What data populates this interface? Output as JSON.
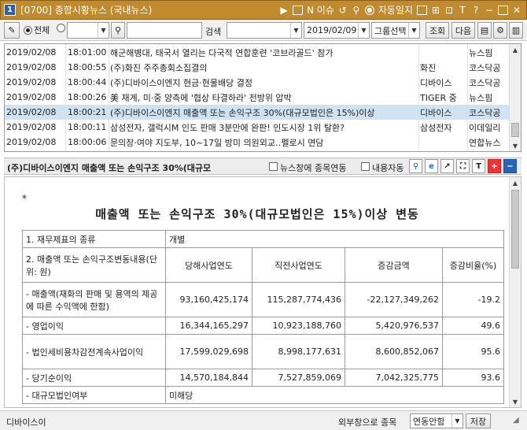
{
  "window": {
    "number": "1",
    "title": "[0700] 종합시황뉴스 (국내뉴스)",
    "buttons": {
      "issue": "N 이슈",
      "autodiary": "자동일지"
    }
  },
  "toolbar": {
    "radio_all": "전체",
    "search_label": "검색",
    "date": "2019/02/09",
    "combo_select": "그룹선택",
    "btn_query": "조회",
    "btn_next": "다음"
  },
  "news": {
    "rows": [
      {
        "date": "2019/02/08",
        "time": "18:01:00",
        "title": "해군해병대, 태국서 열리는 다국적 연합훈련 '코브라골드' 참가",
        "tag": "",
        "source": "뉴스핌",
        "selected": false
      },
      {
        "date": "2019/02/08",
        "time": "18:00:55",
        "title": "(주)화진 주주총회소집결의",
        "tag": "화진",
        "source": "코스닥공",
        "selected": false
      },
      {
        "date": "2019/02/08",
        "time": "18:00:44",
        "title": "(주)디바이스이엔지 현금·현물배당 결정",
        "tag": "디바이스",
        "source": "코스닥공",
        "selected": false
      },
      {
        "date": "2019/02/08",
        "time": "18:00:26",
        "title": "美 재계, 미·중 양측에 '협상 타결하라' 전방위 압박",
        "tag": "TIGER 중",
        "source": "뉴스핌",
        "selected": false
      },
      {
        "date": "2019/02/08",
        "time": "18:00:21",
        "title": "(주)디바이스이엔지 매출액 또는 손익구조 30%(대규모법인은 15%)이상",
        "tag": "디바이스",
        "source": "코스닥공",
        "selected": true
      },
      {
        "date": "2019/02/08",
        "time": "18:00:11",
        "title": "삼성전자, 갤럭시M 인도 판매 3분만에 완판! 인도시장 1위 탈환?",
        "tag": "삼성전자",
        "source": "이데일리",
        "selected": false
      },
      {
        "date": "2019/02/08",
        "time": "18:00:06",
        "title": "문의장·여야 지도부, 10~17일 방미 의원외교‥펠로시 면담",
        "tag": "",
        "source": "연합뉴스",
        "selected": false
      }
    ]
  },
  "headline": {
    "title": "(주)디바이스이엔지 매출액 또는 손익구조 30%(대규모",
    "check_link": "뉴스창에 종목연동",
    "check_content": "내용자동"
  },
  "document": {
    "star": "*",
    "title": "매출액 또는 손익구조 30%(대규모법인은 15%)이상 변동",
    "r1_label": "1. 재무제표의 종류",
    "r1_value": "개별",
    "r2_label": "2. 매출액 또는 손익구조변동내용(단위: 원)",
    "h_current": "당해사업연도",
    "h_prev": "직전사업연도",
    "h_diff": "증감금액",
    "h_rate": "증감비율(%)",
    "rows": [
      {
        "label": "- 매출액(재화의 판매 및 용역의 제공에 따른 수익액에 한함)",
        "cur": "93,160,425,174",
        "prev": "115,287,774,436",
        "diff": "-22,127,349,262",
        "rate": "-19.2"
      },
      {
        "label": "- 영업이익",
        "cur": "16,344,165,297",
        "prev": "10,923,188,760",
        "diff": "5,420,976,537",
        "rate": "49.6"
      },
      {
        "label": "- 법인세비용차감전계속사업이익",
        "cur": "17,599,029,698",
        "prev": "8,998,177,631",
        "diff": "8,600,852,067",
        "rate": "95.6"
      },
      {
        "label": "- 당기순이익",
        "cur": "14,570,184,844",
        "prev": "7,527,859,069",
        "diff": "7,042,325,775",
        "rate": "93.6"
      }
    ],
    "r_last_label": "- 대규모법인여부",
    "r_last_value": "미해당"
  },
  "status": {
    "left": "디바이스이",
    "label": "외부창으로 종목",
    "select": "연동안함",
    "save": "저장"
  }
}
